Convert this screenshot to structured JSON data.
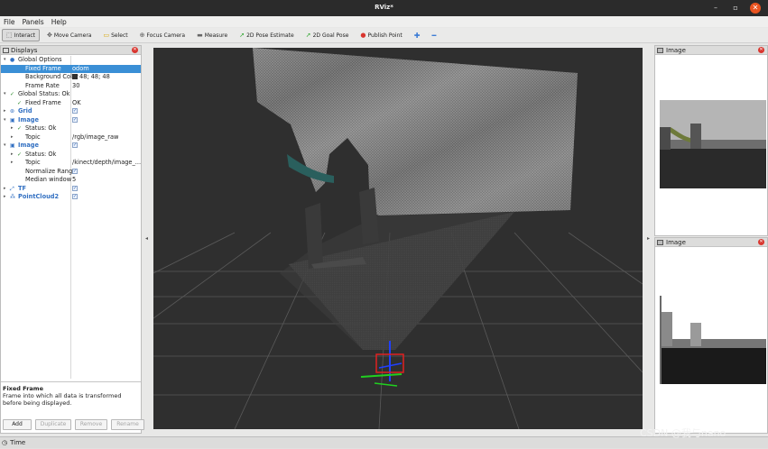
{
  "window": {
    "title": "RViz*",
    "min_glyph": "–",
    "max_glyph": "▫",
    "close_glyph": "✕"
  },
  "menu": [
    "File",
    "Panels",
    "Help"
  ],
  "toolbar": {
    "tools": [
      {
        "label": "Interact",
        "icon": "interact-icon",
        "glyph": "⬚",
        "color": "#555555"
      },
      {
        "label": "Move Camera",
        "icon": "move-camera-icon",
        "glyph": "✥",
        "color": "#555555"
      },
      {
        "label": "Select",
        "icon": "select-icon",
        "glyph": "▭",
        "color": "#d6a400"
      },
      {
        "label": "Focus Camera",
        "icon": "focus-camera-icon",
        "glyph": "⊕",
        "color": "#555555"
      },
      {
        "label": "Measure",
        "icon": "measure-icon",
        "glyph": "▬",
        "color": "#666666"
      },
      {
        "label": "2D Pose Estimate",
        "icon": "pose-estimate-icon",
        "glyph": "➚",
        "color": "#2aa52a"
      },
      {
        "label": "2D Goal Pose",
        "icon": "goal-pose-icon",
        "glyph": "➚",
        "color": "#2aa52a"
      },
      {
        "label": "Publish Point",
        "icon": "publish-point-icon",
        "glyph": "●",
        "color": "#d9362f"
      }
    ],
    "add_glyph": "✚",
    "remove_glyph": "━"
  },
  "displays": {
    "title": "Displays",
    "close_glyph": "✕",
    "rows": [
      {
        "indent": 0,
        "arrow": "▾",
        "icon": "●",
        "icon_color": "#3270c2",
        "name": "Global Options",
        "value": "",
        "selected": false
      },
      {
        "indent": 1,
        "arrow": "",
        "icon": "",
        "name": "Fixed Frame",
        "value": "odom",
        "selected": true
      },
      {
        "indent": 1,
        "arrow": "",
        "icon": "",
        "name": "Background Color",
        "value": "48; 48; 48",
        "swatch": true,
        "selected": false
      },
      {
        "indent": 1,
        "arrow": "",
        "icon": "",
        "name": "Frame Rate",
        "value": "30",
        "selected": false
      },
      {
        "indent": 0,
        "arrow": "▾",
        "icon": "✓",
        "icon_color": "#2a8a2a",
        "name": "Global Status: Ok",
        "value": "",
        "selected": false
      },
      {
        "indent": 1,
        "arrow": "",
        "icon": "✓",
        "icon_color": "#2a8a2a",
        "name": "Fixed Frame",
        "value": "OK",
        "selected": false
      },
      {
        "indent": 0,
        "arrow": "▸",
        "icon": "⊛",
        "icon_color": "#3270c2",
        "name": "Grid",
        "value": "",
        "checkbox": true,
        "blue": true,
        "selected": false
      },
      {
        "indent": 0,
        "arrow": "▾",
        "icon": "▣",
        "icon_color": "#3270c2",
        "name": "Image",
        "value": "",
        "checkbox": true,
        "blue": true,
        "selected": false
      },
      {
        "indent": 1,
        "arrow": "▸",
        "icon": "✓",
        "icon_color": "#2a8a2a",
        "name": "Status: Ok",
        "value": "",
        "selected": false
      },
      {
        "indent": 1,
        "arrow": "▸",
        "icon": "",
        "name": "Topic",
        "value": "/rgb/image_raw",
        "selected": false
      },
      {
        "indent": 0,
        "arrow": "▾",
        "icon": "▣",
        "icon_color": "#3270c2",
        "name": "Image",
        "value": "",
        "checkbox": true,
        "blue": true,
        "selected": false
      },
      {
        "indent": 1,
        "arrow": "▸",
        "icon": "✓",
        "icon_color": "#2a8a2a",
        "name": "Status: Ok",
        "value": "",
        "selected": false
      },
      {
        "indent": 1,
        "arrow": "▸",
        "icon": "",
        "name": "Topic",
        "value": "/kinect/depth/image_...",
        "selected": false
      },
      {
        "indent": 1,
        "arrow": "",
        "icon": "",
        "name": "Normalize Range",
        "value": "",
        "checkbox": true,
        "selected": false
      },
      {
        "indent": 1,
        "arrow": "",
        "icon": "",
        "name": "Median window",
        "value": "5",
        "selected": false
      },
      {
        "indent": 0,
        "arrow": "▸",
        "icon": "⤢",
        "icon_color": "#3270c2",
        "name": "TF",
        "value": "",
        "checkbox": true,
        "blue": true,
        "selected": false
      },
      {
        "indent": 0,
        "arrow": "▸",
        "icon": "⁂",
        "icon_color": "#3270c2",
        "name": "PointCloud2",
        "value": "",
        "checkbox": true,
        "blue": true,
        "selected": false
      }
    ],
    "check_glyph": "✓",
    "description": {
      "title": "Fixed Frame",
      "text": "Frame into which all data is transformed before being displayed."
    },
    "buttons": {
      "add": "Add",
      "duplicate": "Duplicate",
      "remove": "Remove",
      "rename": "Rename"
    }
  },
  "image_panels": {
    "top": {
      "title": "Image",
      "icon": "image-icon",
      "close_glyph": "✕"
    },
    "bottom": {
      "title": "Image",
      "icon": "image-icon",
      "close_glyph": "✕"
    }
  },
  "splitter": {
    "left_glyph": "◂",
    "right_glyph": "▸"
  },
  "time_panel": {
    "title": "Time",
    "icon": "clock-icon",
    "glyph": "◷"
  },
  "watermark": "CSDN @我与nano",
  "colors": {
    "background": "#303030",
    "grid": "#5a5a5a",
    "selection": "#3a8fd6",
    "axis_x": "#e02020",
    "axis_y": "#20d020",
    "axis_z": "#2040ff"
  }
}
